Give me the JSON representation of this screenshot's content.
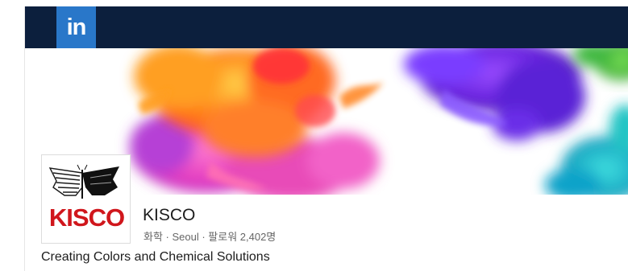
{
  "header": {
    "logo_text": "in",
    "logo_bg": "#2977c9",
    "bar_color": "#0c1f3d"
  },
  "cover": {
    "description_icon": "colored-ink-smoke-banner"
  },
  "company": {
    "logo_text": "KISCO",
    "logo_color": "#d0161c",
    "name": "KISCO",
    "meta": "화학 · Seoul · 팔로워 2,402명",
    "tagline": "Creating Colors and Chemical Solutions"
  }
}
